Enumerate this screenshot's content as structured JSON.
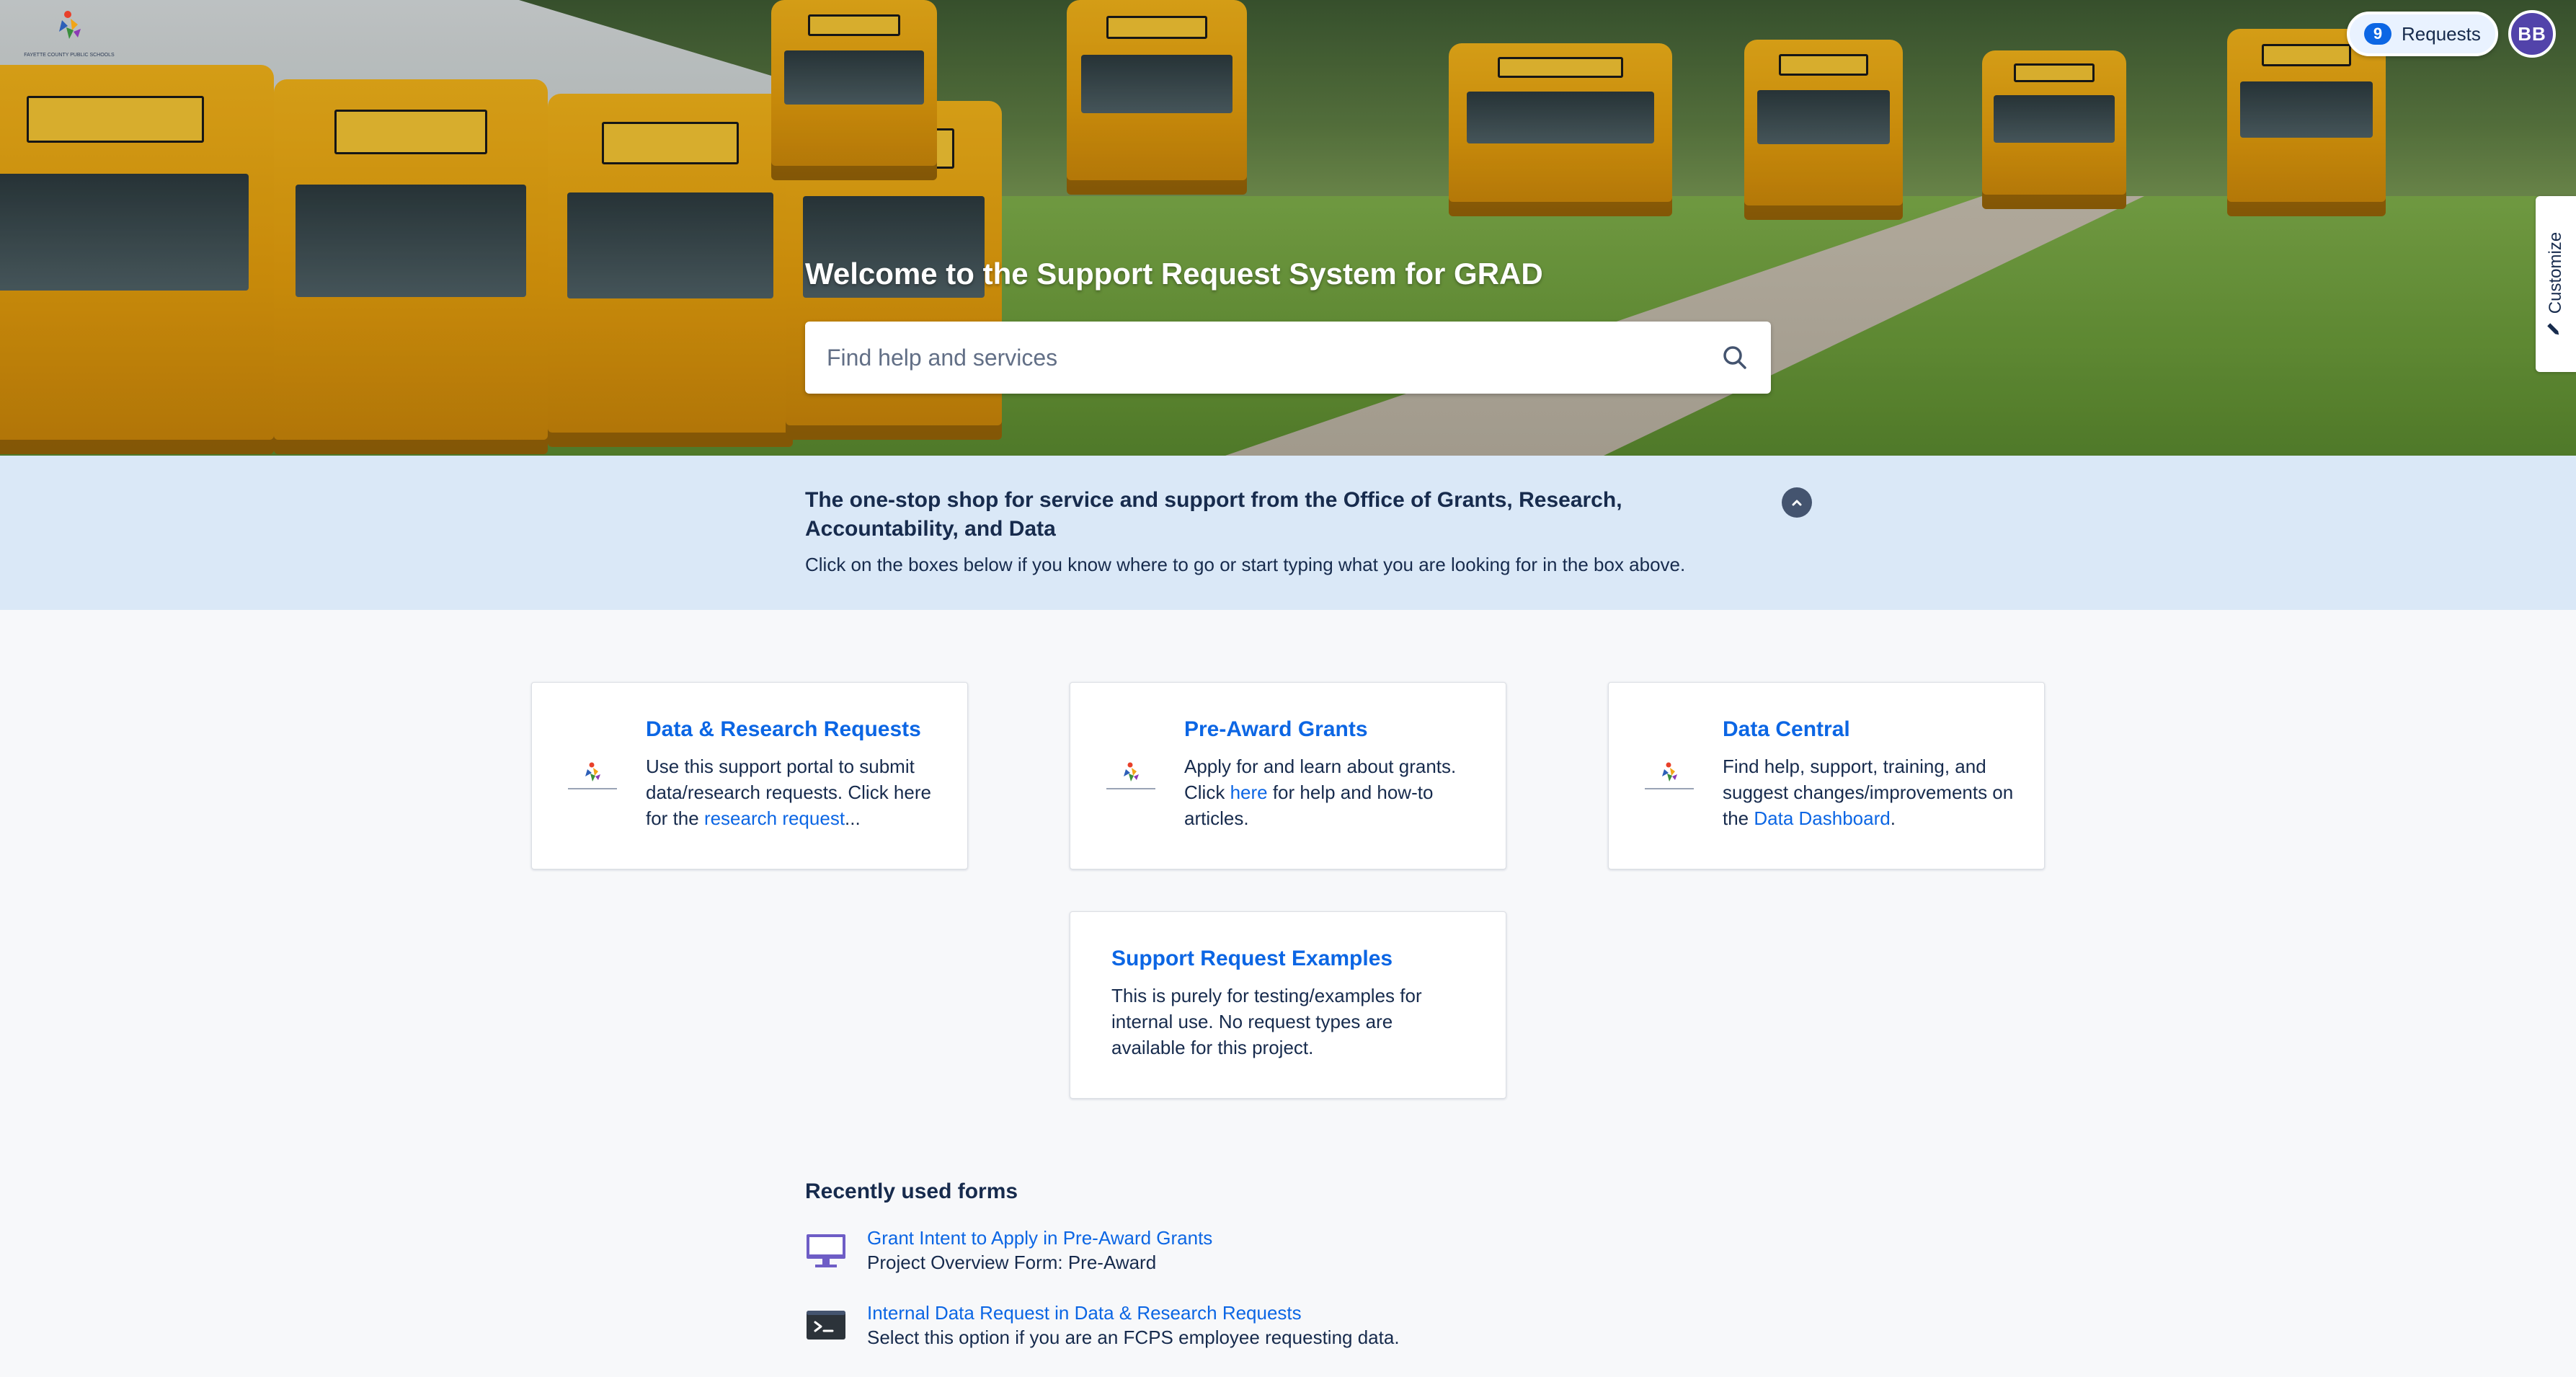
{
  "header": {
    "requests_count": "9",
    "requests_label": "Requests",
    "avatar_initials": "BB",
    "customize_label": "Customize",
    "logo_caption": "FAYETTE COUNTY PUBLIC SCHOOLS"
  },
  "hero": {
    "title": "Welcome to the Support Request System for GRAD",
    "search_placeholder": "Find help and services"
  },
  "banner": {
    "title": "The one-stop shop for service and support from the Office of Grants, Research, Accountability, and Data",
    "text": "Click on the boxes below if you know where to go or start typing what you are looking for in the box above."
  },
  "cards": [
    {
      "title": "Data & Research Requests",
      "desc_before": "Use this support portal to submit data/research requests. Click here for the ",
      "link": "research request",
      "desc_after": "..."
    },
    {
      "title": "Pre-Award Grants",
      "desc_before": "Apply for and learn about grants. Click ",
      "link": "here",
      "desc_after": " for help and how-to articles."
    },
    {
      "title": "Data Central",
      "desc_before": "Find help, support, training, and suggest changes/improvements on the ",
      "link": "Data Dashboard",
      "desc_after": "."
    },
    {
      "title": "Support Request Examples",
      "desc": "This is purely for testing/examples for internal use. No request types are available for this project."
    }
  ],
  "recent": {
    "heading": "Recently used forms",
    "items": [
      {
        "link": "Grant Intent to Apply in Pre-Award Grants",
        "desc": "Project Overview Form: Pre-Award",
        "icon": "monitor-icon"
      },
      {
        "link": "Internal Data Request in Data & Research Requests",
        "desc": "Select this option if you are an FCPS employee requesting data.",
        "icon": "terminal-icon"
      }
    ]
  },
  "colors": {
    "link": "#0c66e4",
    "banner_bg": "#dae8f7",
    "avatar": "#5243aa",
    "page_bg": "#f7f8fa"
  }
}
